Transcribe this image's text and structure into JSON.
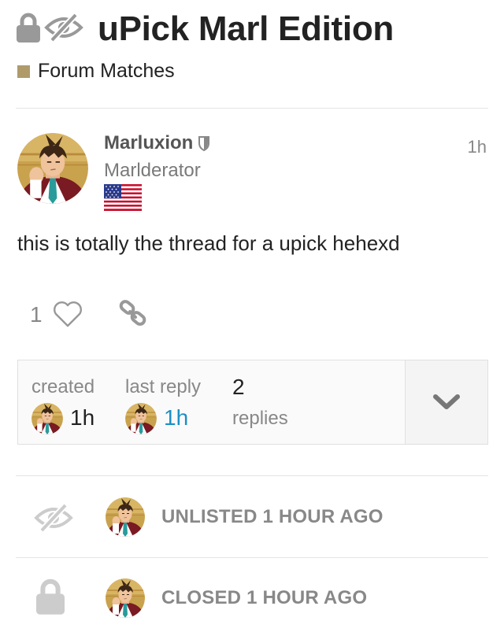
{
  "topic": {
    "title": "uPick Marl Edition",
    "category": {
      "label": "Forum Matches",
      "color": "#b09a6a"
    },
    "status_icons": [
      "lock-icon",
      "unlisted-eye-icon"
    ]
  },
  "post": {
    "username": "Marluxion",
    "user_title": "Marlderator",
    "moderator_badge_icon": "shield-icon",
    "flag": "us-flag",
    "time": "1h",
    "body": "this is totally the thread for a upick hehexd",
    "like_count": "1",
    "actions": [
      "heart-icon",
      "link-icon"
    ]
  },
  "summary": {
    "created_label": "created",
    "created_time": "1h",
    "last_reply_label": "last reply",
    "last_reply_time": "1h",
    "replies_count": "2",
    "replies_label": "replies",
    "expand_icon": "chevron-down-icon"
  },
  "events": [
    {
      "icon": "unlisted-eye-icon",
      "text": "UNLISTED 1 HOUR AGO"
    },
    {
      "icon": "lock-icon",
      "text": "CLOSED 1 HOUR AGO"
    }
  ],
  "colors": {
    "accent": "#1d8fc5",
    "muted": "#888888",
    "border": "#e5e5e5"
  }
}
